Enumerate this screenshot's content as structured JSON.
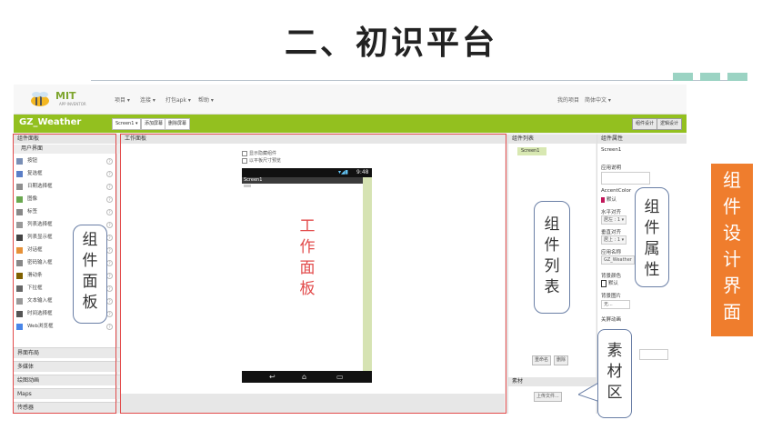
{
  "slide": {
    "title": "二、初识平台",
    "side_label": [
      "组",
      "件",
      "设",
      "计",
      "界",
      "面"
    ]
  },
  "app": {
    "logo_mit": "MIT",
    "logo_sub": "APP INVENTOR",
    "menu": [
      "项目 ▾",
      "连接 ▾",
      "打包apk ▾",
      "帮助 ▾"
    ],
    "menu_right": [
      "我的项目",
      "简体中文 ▾"
    ],
    "project_name": "GZ_Weather",
    "screen_select": "Screen1 ▾",
    "add_screen": "添加屏幕",
    "remove_screen": "删除屏幕",
    "designer_btn": "组件设计",
    "blocks_btn": "逻辑设计"
  },
  "palette": {
    "header": "组件面板",
    "section": "用户界面",
    "items": [
      "按钮",
      "复选框",
      "日期选择框",
      "图像",
      "标签",
      "列表选择框",
      "列表显示框",
      "对话框",
      "密码输入框",
      "滑动条",
      "下拉框",
      "文本输入框",
      "时间选择框",
      "Web浏览框"
    ],
    "categories": [
      "界面布局",
      "多媒体",
      "绘图动画",
      "Maps",
      "传感器"
    ]
  },
  "viewer": {
    "header": "工作面板",
    "check_hidden": "显示隐藏组件",
    "check_tablet": "以平板尺寸预览",
    "status_time": "9:48",
    "screen_title": "Screen1"
  },
  "tree": {
    "header": "组件列表",
    "root": "Screen1",
    "rename_btn": "重命名",
    "delete_btn": "删除",
    "media_header": "素材",
    "upload_btn": "上传文件..."
  },
  "props": {
    "header": "组件属性",
    "component": "Screen1",
    "app_desc_label": "应用说明",
    "accent_label": "AccentColor",
    "accent_value": "默认",
    "halign_label": "水平对齐",
    "halign_value": "居左 : 1 ▾",
    "valign_label": "垂直对齐",
    "valign_value": "居上 : 1 ▾",
    "appname_label": "应用名称",
    "appname_value": "GZ_Weather",
    "bgcolor_label": "背景颜色",
    "bgcolor_value": "默认",
    "bgimage_label": "背景图片",
    "bgimage_value": "无...",
    "anim_label": "关屏动画"
  },
  "annotations": {
    "palette": [
      "组",
      "件",
      "面",
      "板"
    ],
    "viewer": [
      "工",
      "作",
      "面",
      "板"
    ],
    "tree": [
      "组",
      "件",
      "列",
      "表"
    ],
    "props": [
      "组",
      "件",
      "属",
      "性"
    ],
    "media": [
      "素",
      "材",
      "区"
    ]
  },
  "colors": {
    "green_bar": "#93c01f",
    "annotation_red": "#e24b4b",
    "side_orange": "#ef7d2d"
  }
}
